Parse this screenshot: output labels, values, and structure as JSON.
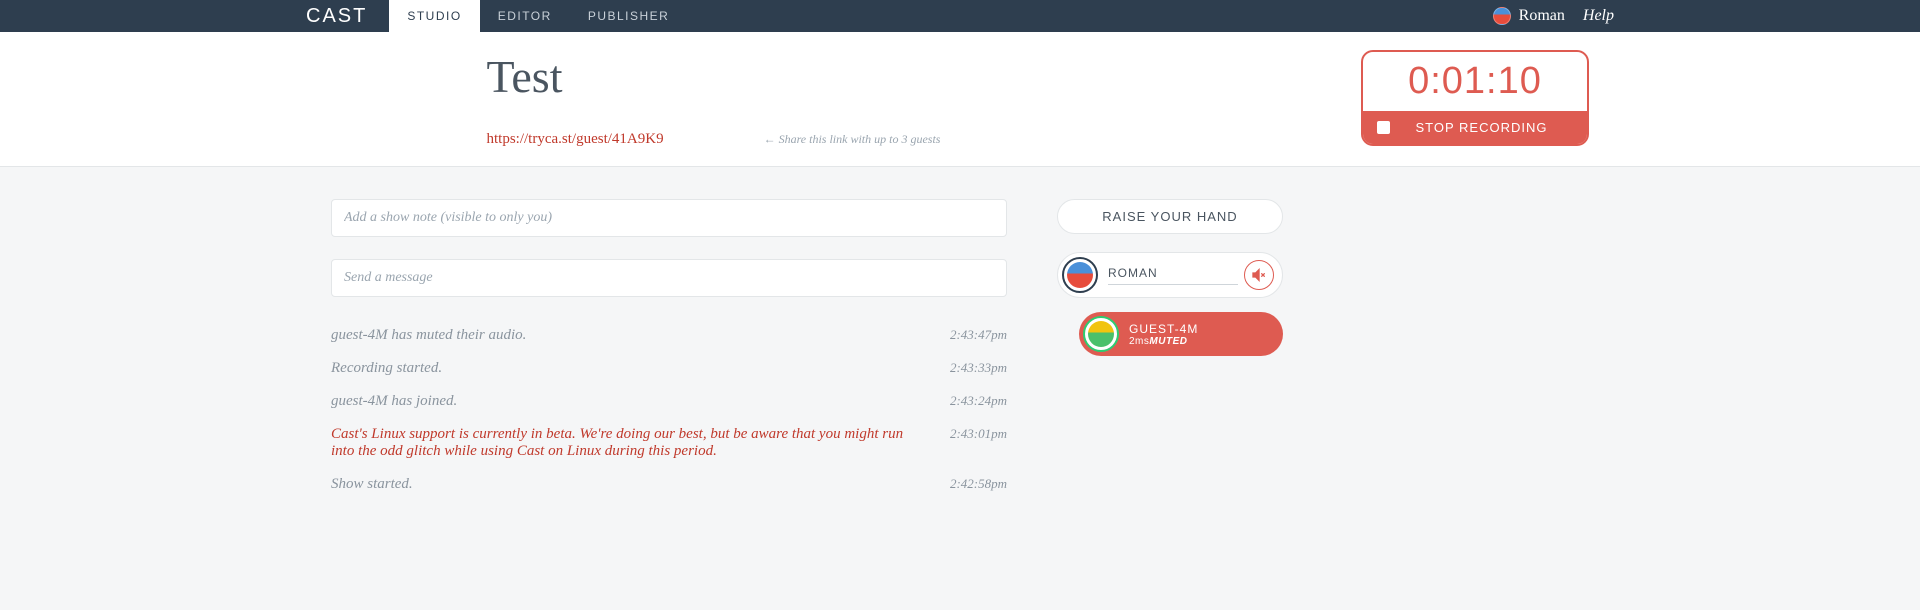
{
  "nav": {
    "brand": "CAST",
    "tabs": [
      {
        "label": "STUDIO",
        "active": true
      },
      {
        "label": "EDITOR",
        "active": false
      },
      {
        "label": "PUBLISHER",
        "active": false
      }
    ],
    "user": "Roman",
    "help": "Help"
  },
  "header": {
    "title": "Test",
    "guest_link": "https://tryca.st/guest/41A9K9",
    "share_hint": "← Share this link with up to 3 guests"
  },
  "timer": {
    "value": "0:01:10",
    "stop_label": "STOP RECORDING"
  },
  "inputs": {
    "note_placeholder": "Add a show note (visible to only you)",
    "message_placeholder": "Send a message"
  },
  "log": [
    {
      "text": "guest-4M has muted their audio.",
      "time": "2:43:47pm",
      "warn": false
    },
    {
      "text": "Recording started.",
      "time": "2:43:33pm",
      "warn": false
    },
    {
      "text": "guest-4M has joined.",
      "time": "2:43:24pm",
      "warn": false
    },
    {
      "text": "Cast's Linux support is currently in beta. We're doing our best, but be aware that you might run into the odd glitch while using Cast on Linux during this period.",
      "time": "2:43:01pm",
      "warn": true
    },
    {
      "text": "Show started.",
      "time": "2:42:58pm",
      "warn": false
    }
  ],
  "right": {
    "raise_hand": "RAISE YOUR HAND",
    "host": {
      "name": "ROMAN"
    },
    "guest": {
      "name": "GUEST-4M",
      "latency": "2ms",
      "status": "MUTED"
    }
  }
}
